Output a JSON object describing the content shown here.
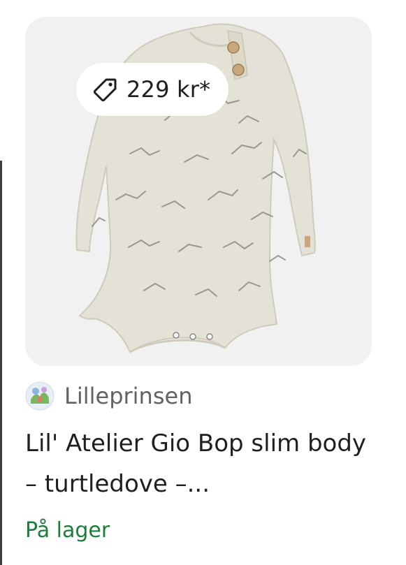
{
  "product": {
    "price": "229 kr*",
    "merchant": "Lilleprinsen",
    "title": "Lil' Atelier Gio Bop slim body – turtledove –...",
    "stock_status": "På lager",
    "image_alt": "Lil' Atelier Gio Bop slim body – turtledove"
  },
  "icons": {
    "price": "tag-icon",
    "merchant": "merchant-favicon"
  },
  "colors": {
    "stock": "#188038",
    "merchant_text": "#5f6368",
    "title_text": "#1f1f1f",
    "card_bg": "#f1f1f1",
    "garment": "#e4e2d6"
  }
}
